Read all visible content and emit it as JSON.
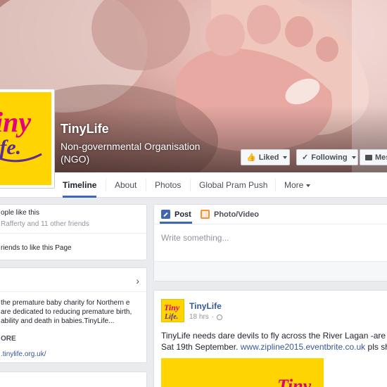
{
  "page": {
    "name": "TinyLife",
    "category": "Non-governmental Organisation (NGO)",
    "logo_text": "Tiny Life"
  },
  "actions": {
    "liked_label": "Liked",
    "following_label": "Following",
    "message_label": "Mes"
  },
  "nav": {
    "tabs": [
      {
        "label": "Timeline",
        "active": true
      },
      {
        "label": "About"
      },
      {
        "label": "Photos"
      },
      {
        "label": "Global Pram Push"
      },
      {
        "label": "More"
      }
    ]
  },
  "likes_card": {
    "count_text": "ople like this",
    "friends_text": "Rafferty and 11 other friends",
    "invite_text": "riends to like this Page"
  },
  "about_card": {
    "text": "the premature baby charity for Northern e are dedicated to reducing premature birth, ability and death in babies.TinyLife...",
    "more_label": "ORE",
    "website": ".tinylife.org.uk/"
  },
  "composer": {
    "tab_post": "Post",
    "tab_photo": "Photo/Video",
    "placeholder": "Write something..."
  },
  "post": {
    "author": "TinyLife",
    "time": "18 hrs",
    "separator": "·",
    "text_1": "TinyLife needs dare devils to fly across the River Lagan -are yo",
    "text_2": "Sat 19th September.",
    "link": "www.zipline2015.eventbrite.co.uk",
    "text_3": "pls shar"
  },
  "colors": {
    "brand_yellow": "#ffd400",
    "brand_pink": "#e4007c",
    "brand_purple": "#5b2d8e",
    "facebook_blue": "#4267b2",
    "link_blue": "#365899"
  },
  "icons": {
    "liked": "thumbs-up-icon",
    "following": "check-icon",
    "message": "message-icon",
    "about_expand": "chevron-right-icon",
    "composer_post": "pencil-icon",
    "composer_photo": "photo-icon",
    "privacy": "globe-icon"
  }
}
